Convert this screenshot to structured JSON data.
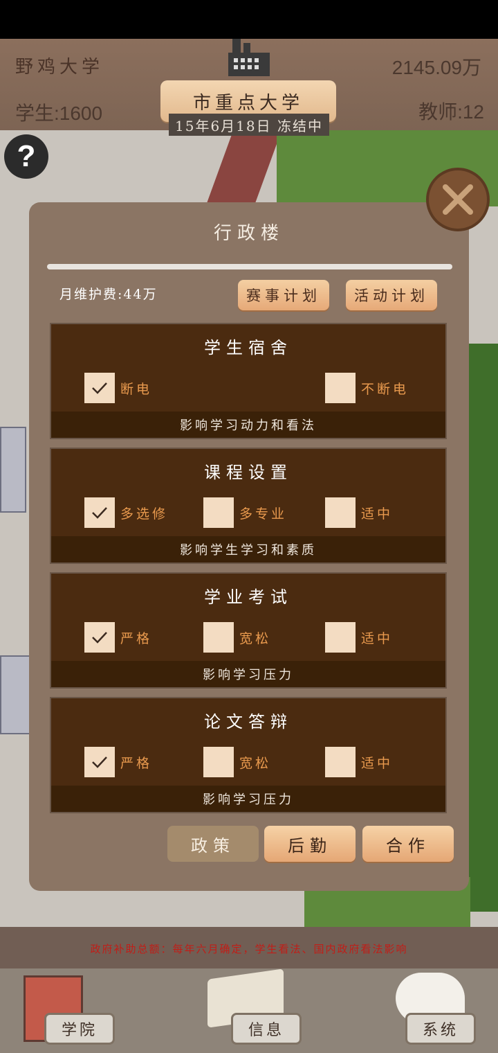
{
  "hud": {
    "university_name": "野鸡大学",
    "funds": "2145.09万",
    "students": "学生:1600",
    "teachers": "教师:12",
    "rank_title": "市重点大学",
    "date_status": "15年6月18日 冻结中"
  },
  "help_icon": "question-mark-icon",
  "modal": {
    "title": "行政楼",
    "monthly_fee": "月维护费:44万",
    "progress": 1.0,
    "buttons": {
      "event_plan": "赛事计划",
      "activity_plan": "活动计划"
    },
    "panels": [
      {
        "title": "学生宿舍",
        "options": [
          {
            "label": "断电",
            "checked": true
          },
          {
            "label": "不断电",
            "checked": false
          }
        ],
        "footer": "影响学习动力和看法"
      },
      {
        "title": "课程设置",
        "options": [
          {
            "label": "多选修",
            "checked": true
          },
          {
            "label": "多专业",
            "checked": false
          },
          {
            "label": "适中",
            "checked": false
          }
        ],
        "footer": "影响学生学习和素质"
      },
      {
        "title": "学业考试",
        "options": [
          {
            "label": "严格",
            "checked": true
          },
          {
            "label": "宽松",
            "checked": false
          },
          {
            "label": "适中",
            "checked": false
          }
        ],
        "footer": "影响学习压力"
      },
      {
        "title": "论文答辩",
        "options": [
          {
            "label": "严格",
            "checked": true
          },
          {
            "label": "宽松",
            "checked": false
          },
          {
            "label": "适中",
            "checked": false
          }
        ],
        "footer": "影响学习压力"
      }
    ],
    "tabs": {
      "policy": "政策",
      "logistics": "后勤",
      "cooperation": "合作"
    }
  },
  "ticker": "政府补助总额：每年六月确定，学生看法、国内政府看法影响",
  "bottom_nav": {
    "college": "学院",
    "info": "信息",
    "system": "系统"
  },
  "colors": {
    "accent": "#e99a4e",
    "panel": "#4b2b10",
    "ticker": "#c11d17"
  }
}
